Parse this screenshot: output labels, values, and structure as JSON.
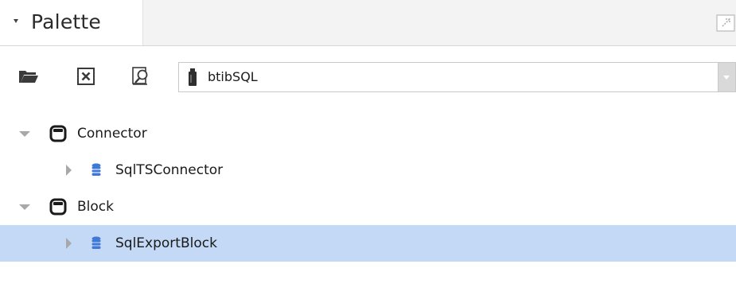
{
  "palette": {
    "title": "Palette"
  },
  "toolbar": {
    "module_selector": {
      "selected": "btibSQL"
    }
  },
  "tree": {
    "nodes": [
      {
        "label": "Connector",
        "kind": "folder",
        "expanded": true,
        "level": 0,
        "selected": false
      },
      {
        "label": "SqlTSConnector",
        "kind": "database",
        "expanded": false,
        "level": 1,
        "selected": false
      },
      {
        "label": "Block",
        "kind": "folder",
        "expanded": true,
        "level": 0,
        "selected": false
      },
      {
        "label": "SqlExportBlock",
        "kind": "database",
        "expanded": false,
        "level": 1,
        "selected": true
      }
    ]
  },
  "colors": {
    "selection": "#c4d9f5",
    "database_icon": "#3f79d6",
    "folder_icon": "#1a1a1a"
  }
}
